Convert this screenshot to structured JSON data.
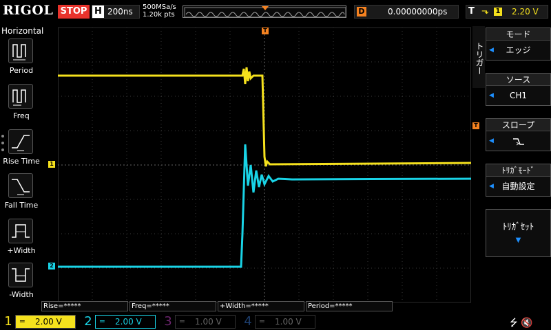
{
  "brand": "RIGOL",
  "status": "STOP",
  "timebase": {
    "label": "H",
    "value": "200ns"
  },
  "sample_rate": "500MSa/s",
  "memory_depth": "1.20k pts",
  "trigger_position": {
    "label": "D",
    "value": "0.00000000ps"
  },
  "trigger_status": {
    "label": "T",
    "source": "1",
    "level": "2.20 V"
  },
  "left_panel": {
    "title": "Horizontal",
    "items": [
      {
        "label": "Period"
      },
      {
        "label": "Freq"
      },
      {
        "label": "Rise Time"
      },
      {
        "label": "Fall Time"
      },
      {
        "label": "+Width"
      },
      {
        "label": "-Width"
      }
    ]
  },
  "menu": {
    "tab": "トリガー",
    "mode": {
      "header": "モード",
      "value": "エッジ"
    },
    "source": {
      "header": "ソース",
      "value": "CH1"
    },
    "slope": {
      "header": "スロープ"
    },
    "trigger_mode": {
      "header": "ﾄﾘｶﾞﾓｰﾄﾞ",
      "value": "自動設定"
    },
    "trigger_set": {
      "label": "ﾄﾘｶﾞｾｯﾄ"
    }
  },
  "measurements": [
    {
      "text": "Rise=*****"
    },
    {
      "text": "Freq=*****"
    },
    {
      "text": "+Width=*****"
    },
    {
      "text": "Period=*****"
    }
  ],
  "channels": [
    {
      "num": "1",
      "coupling": "═",
      "scale": "2.00 V",
      "color": "#f5e11d",
      "active": true
    },
    {
      "num": "2",
      "coupling": "═",
      "scale": "2.00 V",
      "color": "#19d3e6",
      "active": true
    },
    {
      "num": "3",
      "coupling": "═",
      "scale": "1.00 V",
      "color": "#d147d6",
      "active": false
    },
    {
      "num": "4",
      "coupling": "═",
      "scale": "1.00 V",
      "color": "#3a7fe0",
      "active": false
    }
  ],
  "colors": {
    "ch1": "#f5e11d",
    "ch2": "#19d3e6",
    "trigger": "#f58220",
    "stop": "#e8332c"
  },
  "icons": [
    "usb-icon",
    "speaker-icon"
  ]
}
